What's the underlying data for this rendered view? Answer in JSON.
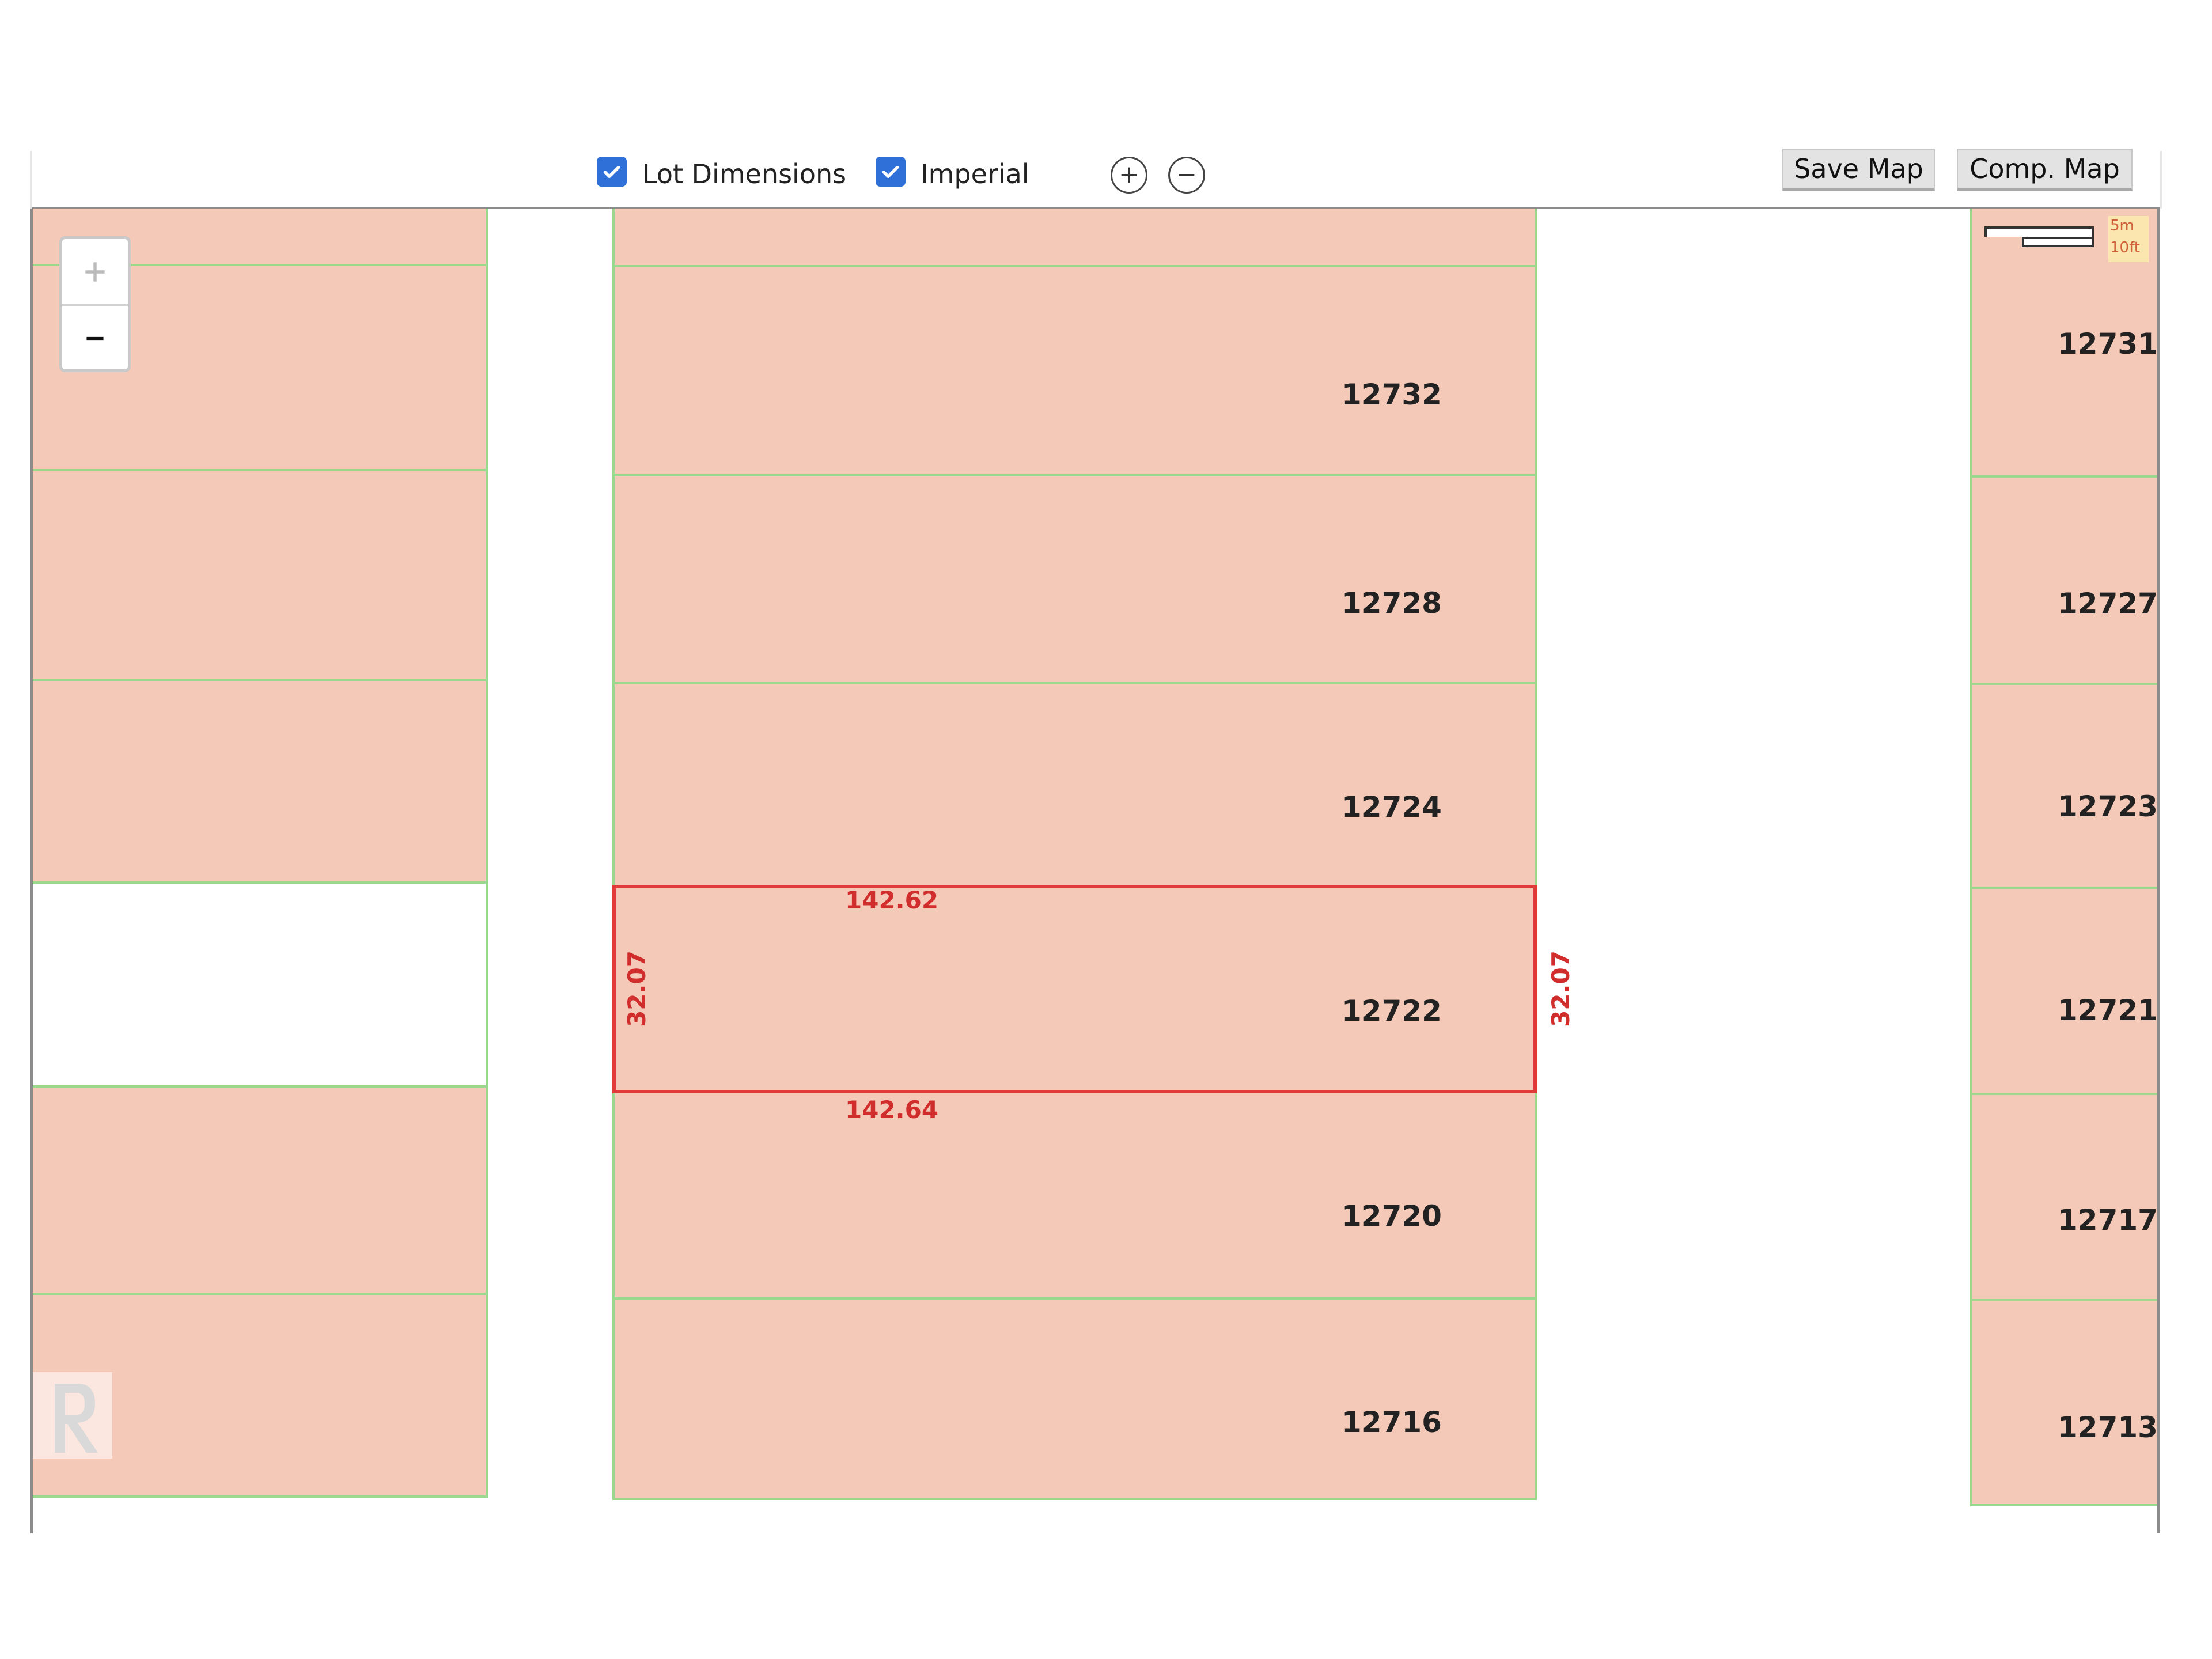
{
  "toolbar": {
    "lot_dimensions_label": "Lot Dimensions",
    "lot_dimensions_checked": true,
    "imperial_label": "Imperial",
    "imperial_checked": true,
    "save_map_label": "Save Map",
    "comp_map_label": "Comp. Map"
  },
  "map": {
    "zoom_in_symbol": "+",
    "zoom_out_symbol": "−",
    "scale": {
      "metric": "5m",
      "imperial": "10ft"
    },
    "lots": {
      "center": [
        "12732",
        "12728",
        "12724",
        "12722",
        "12720",
        "12716"
      ],
      "right": [
        "12731",
        "12727",
        "12723",
        "12721",
        "12717",
        "12713"
      ]
    },
    "selected_lot": {
      "number": "12722",
      "top_length": "142.62",
      "bottom_length": "142.64",
      "left_width": "32.07",
      "right_width": "32.07"
    }
  },
  "colors": {
    "lot_fill": "#f5c9b8",
    "lot_border": "#9ad98d",
    "selected_border": "#e03a3a",
    "checkbox": "#2e6fd8"
  }
}
